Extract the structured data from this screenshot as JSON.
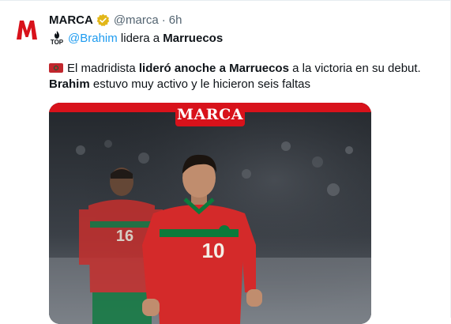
{
  "tweet": {
    "author_name": "MARCA",
    "avatar_letter": "M",
    "handle": "@marca",
    "separator": "·",
    "time": "6h",
    "top_label": "TOP",
    "sub_mention": "@Brahim",
    "sub_middle": " lidera a ",
    "sub_bold": "Marruecos",
    "text": {
      "line1_a": "El madridista ",
      "line1_b": "lideró anoche a Marruecos",
      "line1_c": " a la victoria en su debut.",
      "line2_a": "Brahim",
      "line2_b": " estuvo muy activo y le hicieron seis faltas"
    },
    "media": {
      "brand_label": "MARCA",
      "front_number": "10",
      "back_number": "16"
    }
  },
  "colors": {
    "brand_red": "#d8121b",
    "link_blue": "#1d9bf0",
    "verified_gold": "#e2b719",
    "secondary_text": "#536471",
    "kit_red": "#d42a2a",
    "kit_green": "#0b7a3b"
  },
  "icons": {
    "verified": "verified-badge-icon",
    "top": "top-icon",
    "flag": "morocco-flag-icon"
  }
}
